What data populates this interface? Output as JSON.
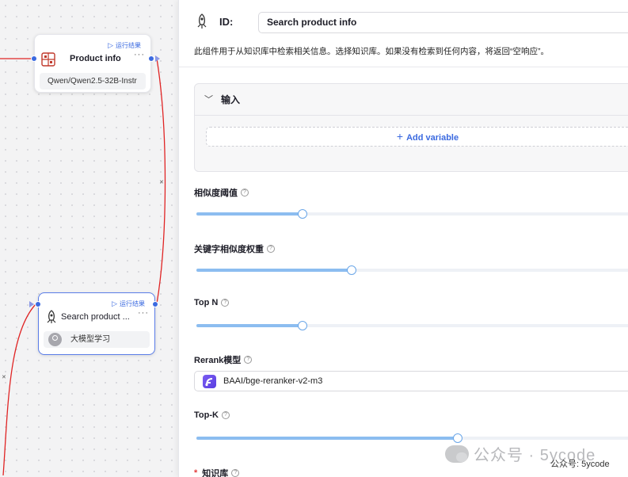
{
  "canvas": {
    "node_llm": {
      "title": "Product info",
      "run_label": "运行结果",
      "model": "Qwen/Qwen2.5-32B-Instr",
      "more": "···"
    },
    "node_retrieval": {
      "title": "Search product ...",
      "run_label": "运行结果",
      "knowledge_base": "大模型学习",
      "more": "···"
    },
    "edge_colors": {
      "active": "#e02424",
      "handle": "#3b6ae0"
    }
  },
  "panel": {
    "id_label": "ID:",
    "id_value": "Search product info",
    "description": "此组件用于从知识库中检索相关信息。选择知识库。如果没有检索到任何内容，将返回“空响应”。",
    "inputs_section": {
      "title": "输入",
      "add_variable": "Add variable"
    },
    "similarity_threshold": {
      "label": "相似度阈值",
      "value": 0.24
    },
    "keyword_weight": {
      "label": "关键字相似度权重",
      "value": 0.35
    },
    "top_n": {
      "label": "Top N",
      "value": 0.24
    },
    "rerank_model": {
      "label": "Rerank模型",
      "value": "BAAI/bge-reranker-v2-m3"
    },
    "top_k": {
      "label": "Top-K",
      "value": 0.59
    },
    "knowledge_base": {
      "label": "知识库",
      "required_mark": "*"
    }
  },
  "watermark": {
    "text": "公众号 · 5ycode",
    "caption": "公众号: 5ycode"
  },
  "colors": {
    "accent": "#3b6ae0",
    "slider_fill": "#8cbdf0",
    "required": "#e23b3b"
  }
}
